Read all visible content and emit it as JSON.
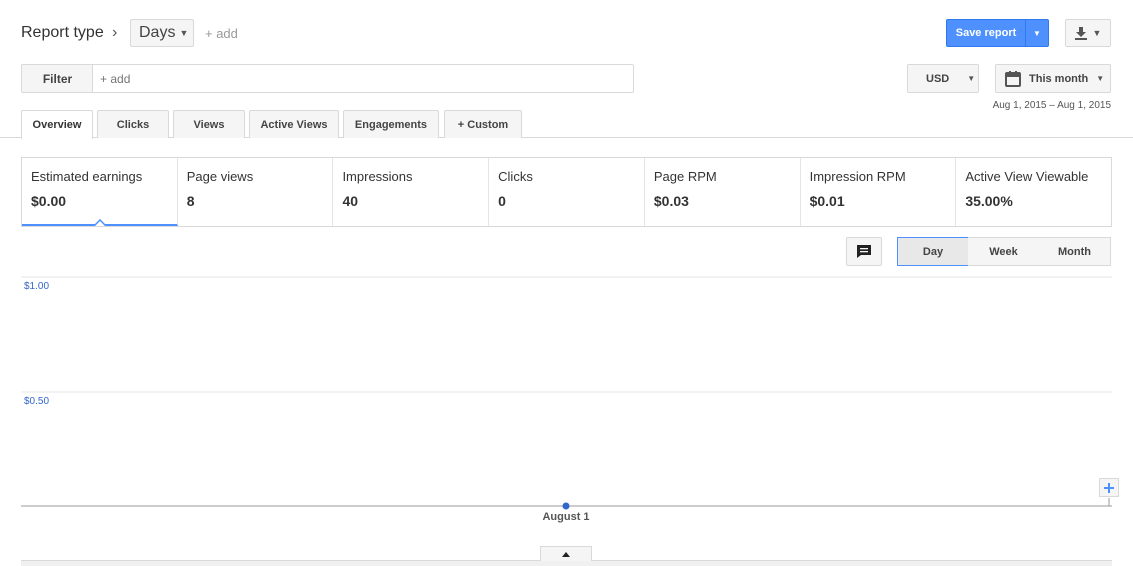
{
  "header": {
    "report_type": "Report type",
    "breadcrumb_chevron": "›",
    "dimension": "Days",
    "add_dimension": "+ add",
    "save_report": "Save report",
    "caret": "▼"
  },
  "filter": {
    "label": "Filter",
    "placeholder": "+ add",
    "value": ""
  },
  "currency": {
    "value": "USD"
  },
  "date": {
    "label": "This month",
    "range": "Aug 1, 2015 – Aug 1, 2015"
  },
  "tabs": [
    {
      "label": "Overview",
      "active": true
    },
    {
      "label": "Clicks"
    },
    {
      "label": "Views"
    },
    {
      "label": "Active Views"
    },
    {
      "label": "Engagements"
    },
    {
      "label": "+ Custom"
    }
  ],
  "metrics": [
    {
      "label": "Estimated earnings",
      "value": "$0.00",
      "selected": true
    },
    {
      "label": "Page views",
      "value": "8"
    },
    {
      "label": "Impressions",
      "value": "40"
    },
    {
      "label": "Clicks",
      "value": "0"
    },
    {
      "label": "Page RPM",
      "value": "$0.03"
    },
    {
      "label": "Impression RPM",
      "value": "$0.01"
    },
    {
      "label": "Active View Viewable",
      "value": "35.00%"
    }
  ],
  "granularity": {
    "options": [
      "Day",
      "Week",
      "Month"
    ],
    "selected": "Day"
  },
  "chart": {
    "ytick_top": "$1.00",
    "ytick_mid": "$0.50",
    "xtick": "August 1",
    "series_color": "#3366cc"
  },
  "chart_data": {
    "type": "line",
    "x": [
      "August 1"
    ],
    "series": [
      {
        "values": [
          0.0
        ]
      }
    ],
    "yticks": [
      "$1.00",
      "$0.50"
    ],
    "ylim": [
      0,
      1.0
    ],
    "grid": true
  },
  "icons": {
    "annotation": "comment-icon",
    "download": "download-icon",
    "calendar": "calendar-icon",
    "zoom": "plus-icon",
    "collapse": "caret-up-icon"
  }
}
